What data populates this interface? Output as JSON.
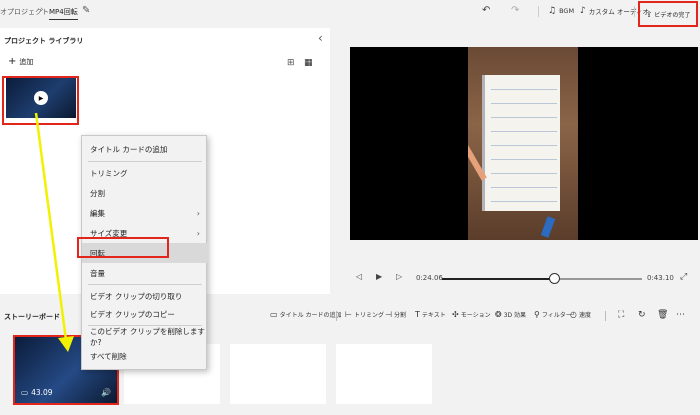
{
  "titlebar": {
    "back_crumb": "オプロジェクト",
    "sep": "›",
    "project_name": "MP4回転",
    "undo_icon": "undo-icon",
    "redo_icon": "redo-icon",
    "bgm_label": "BGM",
    "custom_audio_label": "カスタム オーディオ",
    "finish_label": "ビデオの完了",
    "more_icon": "⋯"
  },
  "library": {
    "title": "プロジェクト ライブラリ",
    "add_label": "追加",
    "collapse_icon": "‹"
  },
  "preview": {
    "current_time": "0:24.06",
    "end_time": "0:43.10",
    "progress_fraction": 0.56
  },
  "storyboard": {
    "label": "ストーリーボード",
    "tools": [
      "タイトル カードの追加",
      "トリミング",
      "分割",
      "テキスト",
      "モーション",
      "3D 効果",
      "フィルター",
      "速度"
    ],
    "clip_duration": "43.09"
  },
  "context_menu": {
    "items": [
      "タイトル カードの追加",
      "トリミング",
      "分割",
      "編集",
      "サイズ変更",
      "回転",
      "音量",
      "ビデオ クリップの切り取り",
      "ビデオ クリップのコピー",
      "このビデオ クリップを削除しますか?",
      "すべて削除"
    ],
    "highlighted": "回転"
  },
  "colors": {
    "annotation_red": "#e2261b",
    "annotation_arrow": "#f2f200"
  }
}
